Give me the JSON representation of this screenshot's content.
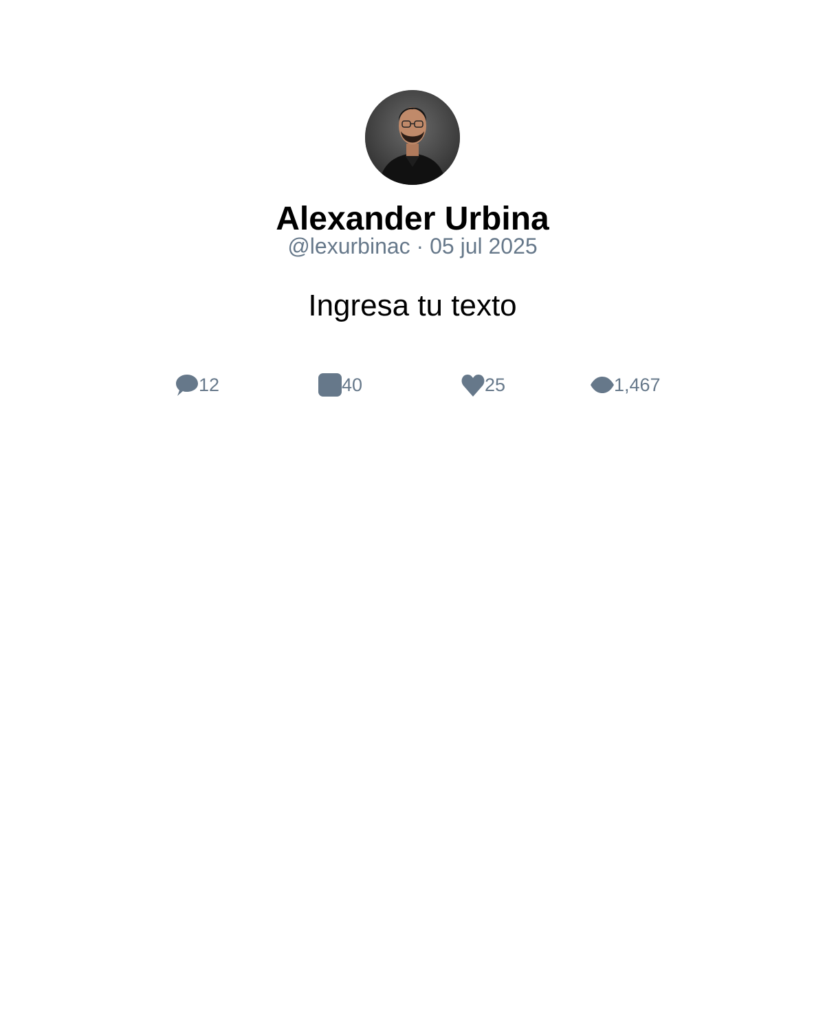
{
  "post": {
    "author": {
      "display_name": "Alexander Urbina",
      "meta_line": "@lexurbinac · 05 jul 2025"
    },
    "text": "Ingresa tu texto",
    "stats": {
      "replies": "12",
      "reposts": "40",
      "likes": "25",
      "views": "1,467"
    }
  },
  "icons": {
    "replies": "speech-bubble-icon",
    "reposts": "repost-square-icon",
    "likes": "heart-icon",
    "views": "eye-icon"
  },
  "colors": {
    "meta_gray": "#66788a",
    "text_black": "#000000",
    "background": "#ffffff"
  }
}
